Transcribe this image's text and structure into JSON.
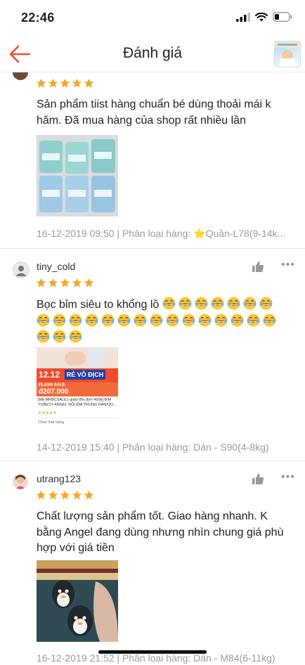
{
  "status_bar": {
    "time": "22:46"
  },
  "header": {
    "title": "Đánh giá"
  },
  "reviews": [
    {
      "stars": 5,
      "text": "Sản phẩm tiist hàng chuẩn bé dùng thoải mái k hăm. Đã mua hàng của shop rất nhiều lần",
      "meta": "16-12-2019 09:50 | Phân loại hàng: ⭐Quần-L78(9-14k..."
    },
    {
      "username": "tiny_cold",
      "stars": 5,
      "text": "Bọc bỉm siêu to khổng lồ",
      "emoji_count": 25,
      "emoji_icon": "laughing-tears-emoji",
      "image": {
        "date_badge": "12.12",
        "banner": "RẺ VÔ ĐỊCH",
        "flash_label": "FLASH SALE",
        "price": "đ207.000",
        "desc": "[Mã MKBCSALE1 giảm 8% đơn 400k] BỈM YUBEST ANGEL NỘI ĐỊA TRUNG DÂN/QU...",
        "footer": "Chọn loại hàng"
      },
      "meta": "14-12-2019 15:40 | Phân loại hàng: Dán - S90(4-8kg)"
    },
    {
      "username": "utrang123",
      "stars": 5,
      "text": "Chất lượng sản phẩm tốt. Giao hàng nhanh. K bằng Angel đang dùng nhưng nhìn chung giá phù hợp với giá tiền",
      "meta": "16-12-2019 21:52 | Phân loại hàng: Dán - M84(6-11kg)"
    }
  ],
  "colors": {
    "star": "#f5a623",
    "accent": "#ee4d2d",
    "muted": "#9b9b9b"
  },
  "icons": [
    "back-arrow-icon",
    "like-icon",
    "more-icon",
    "star-icon",
    "signal-icon",
    "wifi-icon",
    "battery-icon"
  ]
}
